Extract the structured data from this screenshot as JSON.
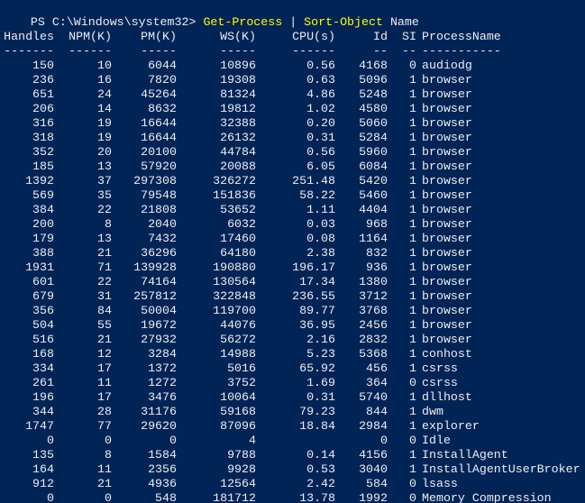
{
  "prompt": {
    "path": "PS C:\\Windows\\system32>",
    "cmd1": "Get-Process",
    "pipe": "|",
    "cmd2": "Sort-Object",
    "arg": "Name"
  },
  "headers": [
    "Handles",
    "NPM(K)",
    "PM(K)",
    "WS(K)",
    "CPU(s)",
    "Id",
    "SI",
    "ProcessName"
  ],
  "separators": [
    "-------",
    "------",
    "-----",
    "-----",
    "------",
    "--",
    "--",
    "-----------"
  ],
  "rows": [
    [
      "150",
      "10",
      "6044",
      "10896",
      "0.56",
      "4168",
      "0",
      "audiodg"
    ],
    [
      "236",
      "16",
      "7820",
      "19308",
      "0.63",
      "5096",
      "1",
      "browser"
    ],
    [
      "651",
      "24",
      "45264",
      "81324",
      "4.86",
      "5248",
      "1",
      "browser"
    ],
    [
      "206",
      "14",
      "8632",
      "19812",
      "1.02",
      "4580",
      "1",
      "browser"
    ],
    [
      "316",
      "19",
      "16644",
      "32388",
      "0.20",
      "5060",
      "1",
      "browser"
    ],
    [
      "318",
      "19",
      "16644",
      "26132",
      "0.31",
      "5284",
      "1",
      "browser"
    ],
    [
      "352",
      "20",
      "20100",
      "44784",
      "0.56",
      "5960",
      "1",
      "browser"
    ],
    [
      "185",
      "13",
      "57920",
      "20088",
      "6.05",
      "6084",
      "1",
      "browser"
    ],
    [
      "1392",
      "37",
      "297308",
      "326272",
      "251.48",
      "5420",
      "1",
      "browser"
    ],
    [
      "569",
      "35",
      "79548",
      "151836",
      "58.22",
      "5460",
      "1",
      "browser"
    ],
    [
      "384",
      "22",
      "21808",
      "53652",
      "1.11",
      "4404",
      "1",
      "browser"
    ],
    [
      "200",
      "8",
      "2040",
      "6032",
      "0.03",
      "968",
      "1",
      "browser"
    ],
    [
      "179",
      "13",
      "7432",
      "17460",
      "0.08",
      "1164",
      "1",
      "browser"
    ],
    [
      "388",
      "21",
      "36296",
      "64180",
      "2.38",
      "832",
      "1",
      "browser"
    ],
    [
      "1931",
      "71",
      "139928",
      "190880",
      "196.17",
      "936",
      "1",
      "browser"
    ],
    [
      "601",
      "22",
      "74164",
      "130564",
      "17.34",
      "1380",
      "1",
      "browser"
    ],
    [
      "679",
      "31",
      "257812",
      "322848",
      "236.55",
      "3712",
      "1",
      "browser"
    ],
    [
      "356",
      "84",
      "50004",
      "119700",
      "89.77",
      "3768",
      "1",
      "browser"
    ],
    [
      "504",
      "55",
      "19672",
      "44076",
      "36.95",
      "2456",
      "1",
      "browser"
    ],
    [
      "516",
      "21",
      "27932",
      "56272",
      "2.16",
      "2832",
      "1",
      "browser"
    ],
    [
      "168",
      "12",
      "3284",
      "14988",
      "5.23",
      "5368",
      "1",
      "conhost"
    ],
    [
      "334",
      "17",
      "1372",
      "5016",
      "65.92",
      "456",
      "1",
      "csrss"
    ],
    [
      "261",
      "11",
      "1272",
      "3752",
      "1.69",
      "364",
      "0",
      "csrss"
    ],
    [
      "196",
      "17",
      "3476",
      "10064",
      "0.31",
      "5740",
      "1",
      "dllhost"
    ],
    [
      "344",
      "28",
      "31176",
      "59168",
      "79.23",
      "844",
      "1",
      "dwm"
    ],
    [
      "1747",
      "77",
      "29620",
      "87096",
      "18.84",
      "2984",
      "1",
      "explorer"
    ],
    [
      "0",
      "0",
      "0",
      "4",
      "",
      "0",
      "0",
      "Idle"
    ],
    [
      "135",
      "8",
      "1584",
      "9788",
      "0.14",
      "4156",
      "1",
      "InstallAgent"
    ],
    [
      "164",
      "11",
      "2356",
      "9928",
      "0.53",
      "3040",
      "1",
      "InstallAgentUserBroker"
    ],
    [
      "912",
      "21",
      "4936",
      "12564",
      "2.42",
      "584",
      "0",
      "lsass"
    ],
    [
      "0",
      "0",
      "548",
      "181712",
      "13.78",
      "1992",
      "0",
      "Memory Compression"
    ]
  ],
  "colors": {
    "background": "#012456",
    "text": "#eeedf0",
    "command": "#ffff00"
  }
}
